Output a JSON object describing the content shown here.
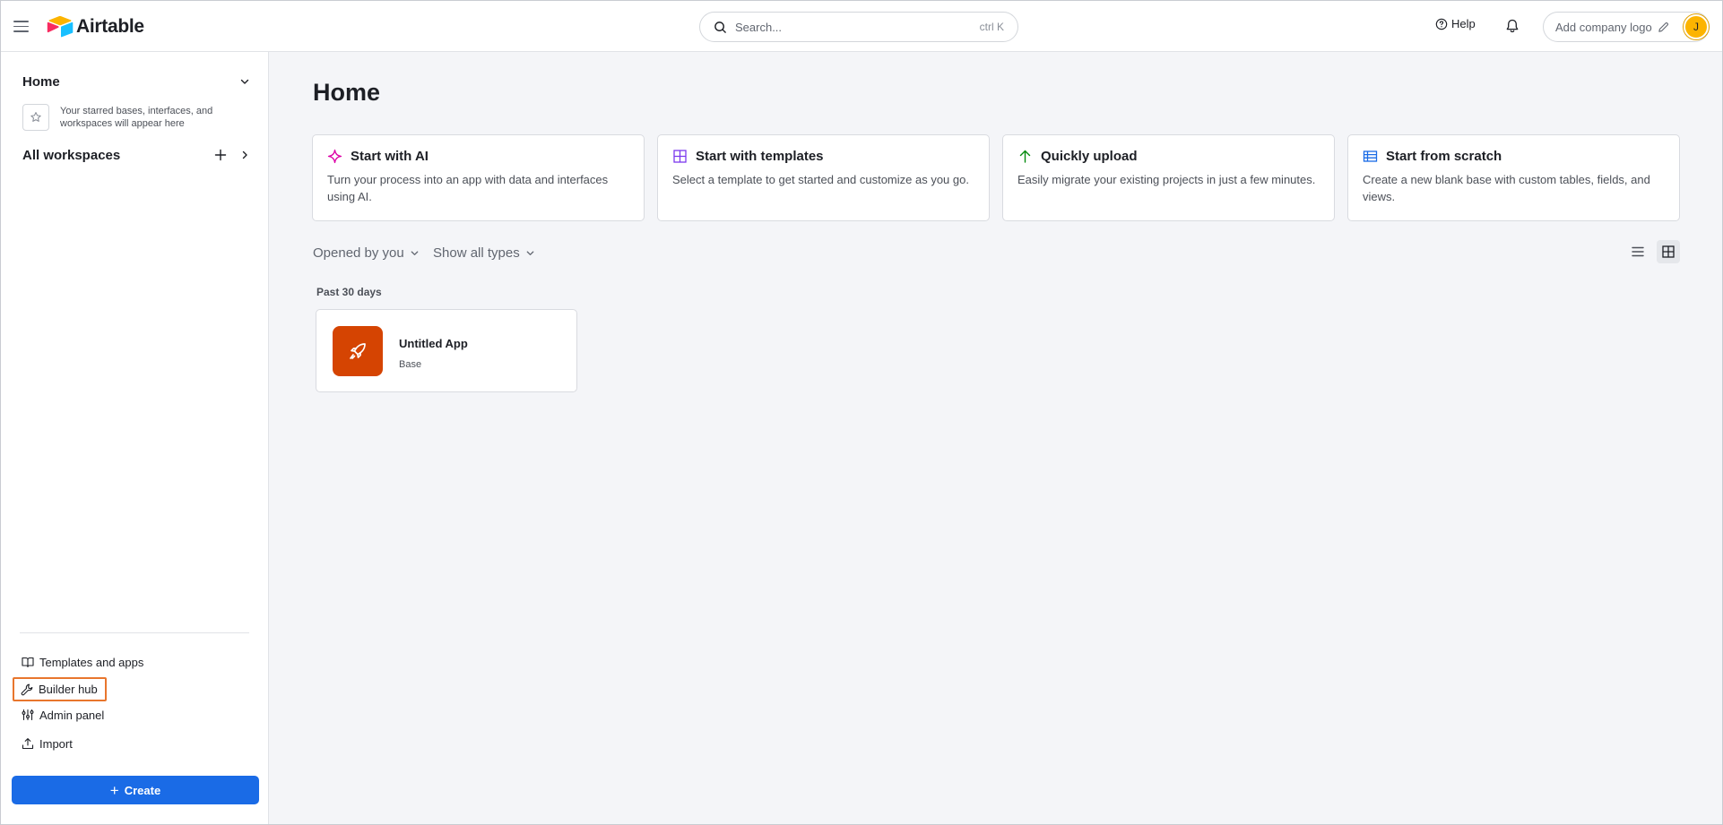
{
  "header": {
    "app_name": "Airtable",
    "search_placeholder": "Search...",
    "search_shortcut": "ctrl K",
    "help_label": "Help",
    "company_logo_label": "Add company logo",
    "avatar_initial": "J",
    "avatar_color": "#fcb400"
  },
  "sidebar": {
    "home_label": "Home",
    "starred_text": "Your starred bases, interfaces, and workspaces will appear here",
    "workspaces_label": "All workspaces",
    "links": {
      "templates": "Templates and apps",
      "builder_hub": "Builder hub",
      "admin_panel": "Admin panel",
      "import": "Import"
    },
    "create_label": "Create",
    "highlight_color": "#e8762d",
    "create_color": "#1a6be6"
  },
  "main": {
    "title": "Home",
    "cards": [
      {
        "title": "Start with AI",
        "desc": "Turn your process into an app with data and interfaces using AI.",
        "icon": "sparkle-icon"
      },
      {
        "title": "Start with templates",
        "desc": "Select a template to get started and customize as you go.",
        "icon": "grid-icon"
      },
      {
        "title": "Quickly upload",
        "desc": "Easily migrate your existing projects in just a few minutes.",
        "icon": "arrow-up-icon"
      },
      {
        "title": "Start from scratch",
        "desc": "Create a new blank base with custom tables, fields, and views.",
        "icon": "table-icon"
      }
    ],
    "filters": {
      "opened_by": "Opened by you",
      "types": "Show all types"
    },
    "section_label": "Past 30 days",
    "recent": [
      {
        "name": "Untitled App",
        "type": "Base",
        "icon": "rocket-icon",
        "color": "#d54402"
      }
    ]
  }
}
